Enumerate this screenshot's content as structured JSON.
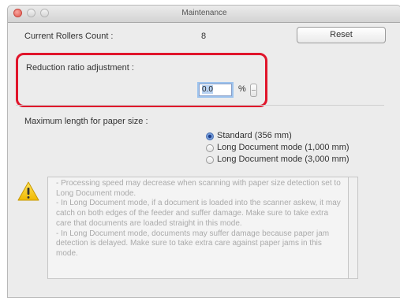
{
  "window": {
    "title": "Maintenance"
  },
  "rollers": {
    "label": "Current Rollers Count :",
    "value": "8",
    "reset_label": "Reset"
  },
  "reduction": {
    "label": "Reduction ratio adjustment :",
    "value": "0.0",
    "unit": "%"
  },
  "paper_size": {
    "label": "Maximum length for paper size :",
    "options": [
      {
        "label": "Standard (356 mm)",
        "selected": true
      },
      {
        "label": "Long Document mode (1,000 mm)",
        "selected": false
      },
      {
        "label": "Long Document mode (3,000 mm)",
        "selected": false
      }
    ]
  },
  "notes": {
    "icon": "warning-icon",
    "text": "- Processing speed may decrease when scanning with paper size detection set to Long Document mode.\n- In Long Document mode, if a document is loaded into the scanner askew, it may catch on both edges of the feeder and suffer damage. Make sure to take extra care that documents are loaded straight in this mode.\n- In Long Document mode, documents may suffer damage because paper jam detection is delayed. Make sure to take extra care against paper jams in this mode."
  },
  "colors": {
    "highlight": "#e0152b",
    "window_bg": "#ececec",
    "radio_selected": "#1e3f8c"
  }
}
